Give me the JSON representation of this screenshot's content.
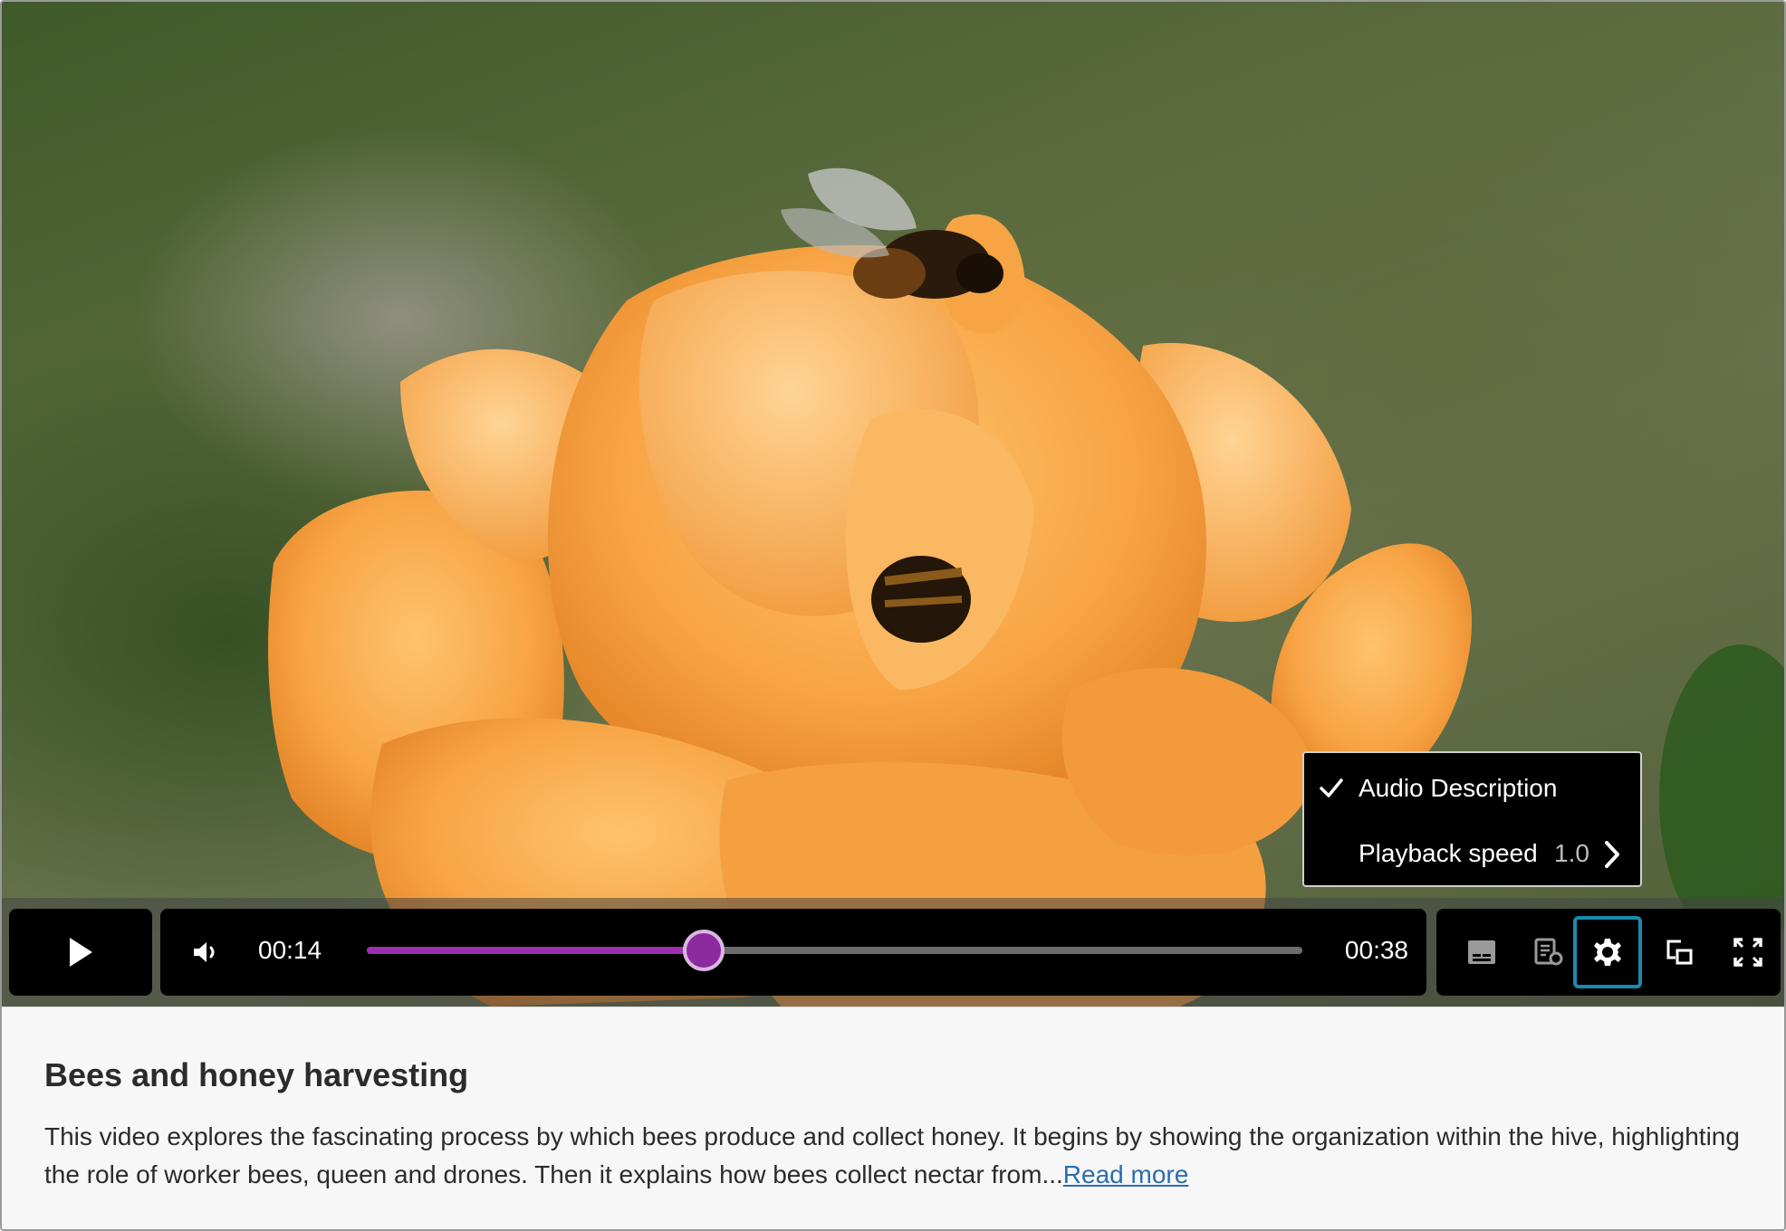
{
  "video": {
    "current_time": "00:14",
    "total_time": "00:38",
    "progress": 0.36,
    "accent_color": "#9b2fae",
    "focus_color": "#1a8bb0"
  },
  "settings_menu": {
    "audio_description_label": "Audio Description",
    "audio_description_checked": true,
    "playback_speed_label": "Playback speed",
    "playback_speed_value": "1.0"
  },
  "controls": {
    "play_icon": "play-icon",
    "volume_icon": "volume-icon",
    "captions_icon": "captions-icon",
    "transcript_icon": "transcript-icon",
    "settings_icon": "gear-icon",
    "pip_icon": "picture-in-picture-icon",
    "fullscreen_icon": "fullscreen-icon"
  },
  "description": {
    "title": "Bees and honey harvesting",
    "body": "This video explores the fascinating process by which bees produce and collect honey. It begins by showing the organization within the hive, highlighting the role of worker bees, queen and drones. Then it explains how bees collect nectar from...",
    "read_more": "Read more"
  }
}
